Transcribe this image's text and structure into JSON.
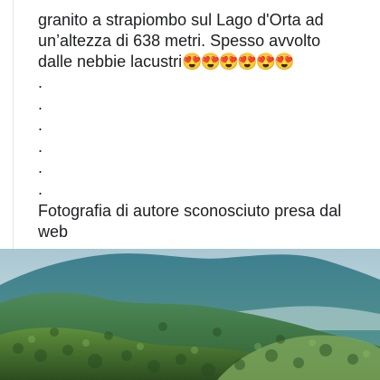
{
  "post": {
    "text_lines": [
      "granito a strapiombo sul Lago d'Orta ad",
      "un’altezza di 638 metri. Spesso avvolto",
      "dalle nebbie lacustri"
    ],
    "emojis": "😍😍😍😍😍😍",
    "dots": [
      ".",
      ".",
      ".",
      ".",
      ".",
      "."
    ],
    "credit_lines": [
      "Fotografia di autore sconosciuto presa dal",
      "web"
    ]
  },
  "photo": {
    "subject_icon": "mountain-landscape-photo"
  }
}
